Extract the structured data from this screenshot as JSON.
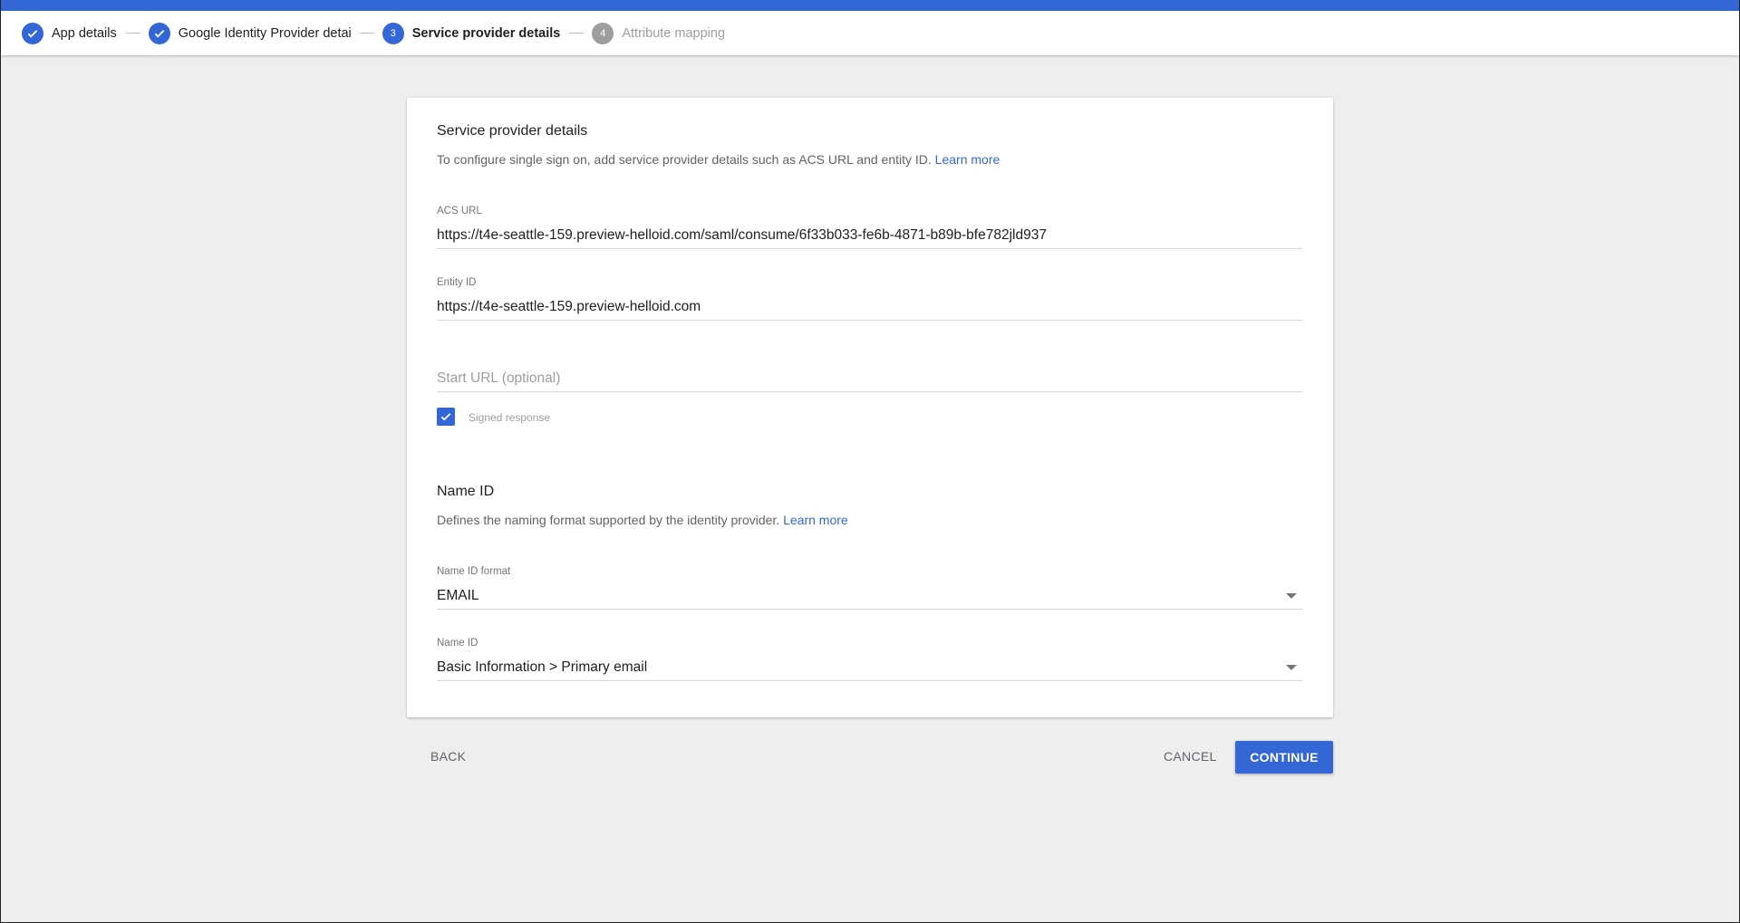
{
  "colors": {
    "accent": "#3367d6",
    "inactive_step": "#9e9e9e"
  },
  "stepper": {
    "steps": [
      {
        "label": "App details",
        "state": "done",
        "icon": "check-icon"
      },
      {
        "label": "Google Identity Provider details",
        "state": "done",
        "icon": "check-icon"
      },
      {
        "label": "Service provider details",
        "state": "active",
        "number": "3"
      },
      {
        "label": "Attribute mapping",
        "state": "todo",
        "number": "4"
      }
    ]
  },
  "service_provider": {
    "title": "Service provider details",
    "description": "To configure single sign on, add service provider details such as ACS URL and entity ID.",
    "learn_more": "Learn more",
    "acs_url": {
      "label": "ACS URL",
      "value": "https://t4e-seattle-159.preview-helloid.com/saml/consume/6f33b033-fe6b-4871-b89b-bfe782jld937"
    },
    "entity_id": {
      "label": "Entity ID",
      "value": "https://t4e-seattle-159.preview-helloid.com"
    },
    "start_url": {
      "placeholder": "Start URL (optional)"
    },
    "signed_response": {
      "label": "Signed response",
      "checked": true
    }
  },
  "name_id": {
    "title": "Name ID",
    "description": "Defines the naming format supported by the identity provider.",
    "learn_more": "Learn more",
    "format": {
      "label": "Name ID format",
      "value": "EMAIL"
    },
    "name_id_field": {
      "label": "Name ID",
      "value": "Basic Information > Primary email"
    }
  },
  "actions": {
    "back": "BACK",
    "cancel": "CANCEL",
    "continue": "CONTINUE"
  }
}
